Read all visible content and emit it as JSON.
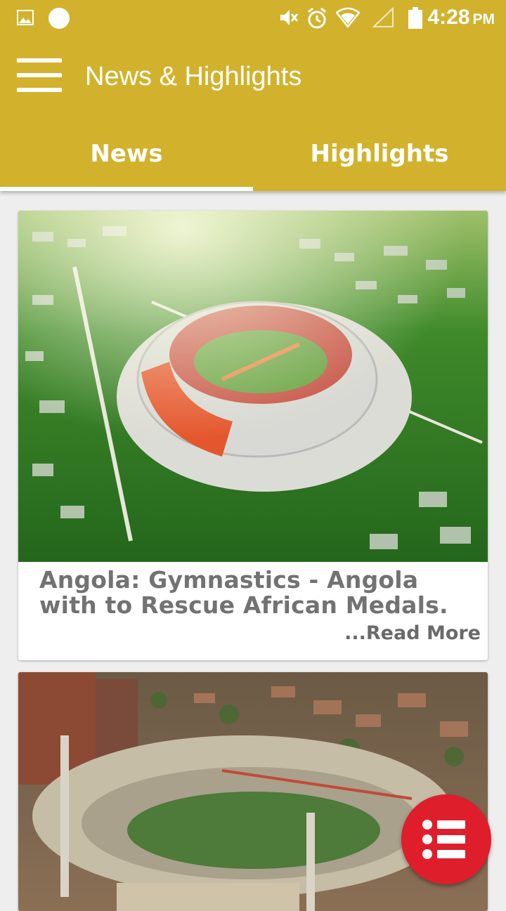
{
  "status_bar": {
    "time": "4:28",
    "ampm": "PM",
    "icons": [
      "image-icon",
      "circle-notification-icon",
      "mute-icon",
      "alarm-icon",
      "wifi-icon",
      "signal-icon",
      "battery-icon"
    ]
  },
  "toolbar": {
    "title": "News & Highlights",
    "menu_icon": "hamburger-menu-icon"
  },
  "tabs": [
    {
      "label": "News",
      "selected": true
    },
    {
      "label": "Highlights",
      "selected": false
    }
  ],
  "articles": [
    {
      "image": "stadium-aerial-photo",
      "headline": "Angola: Gymnastics - Angola with to Rescue African Medals.",
      "read_more": "...Read More"
    },
    {
      "image": "city-stadium-aerial-photo"
    }
  ],
  "fab": {
    "icon": "list-icon"
  },
  "colors": {
    "app_bar": "#d2b22c",
    "fab": "#df1e2c",
    "background": "#eeeeee",
    "headline_text": "#727272"
  }
}
